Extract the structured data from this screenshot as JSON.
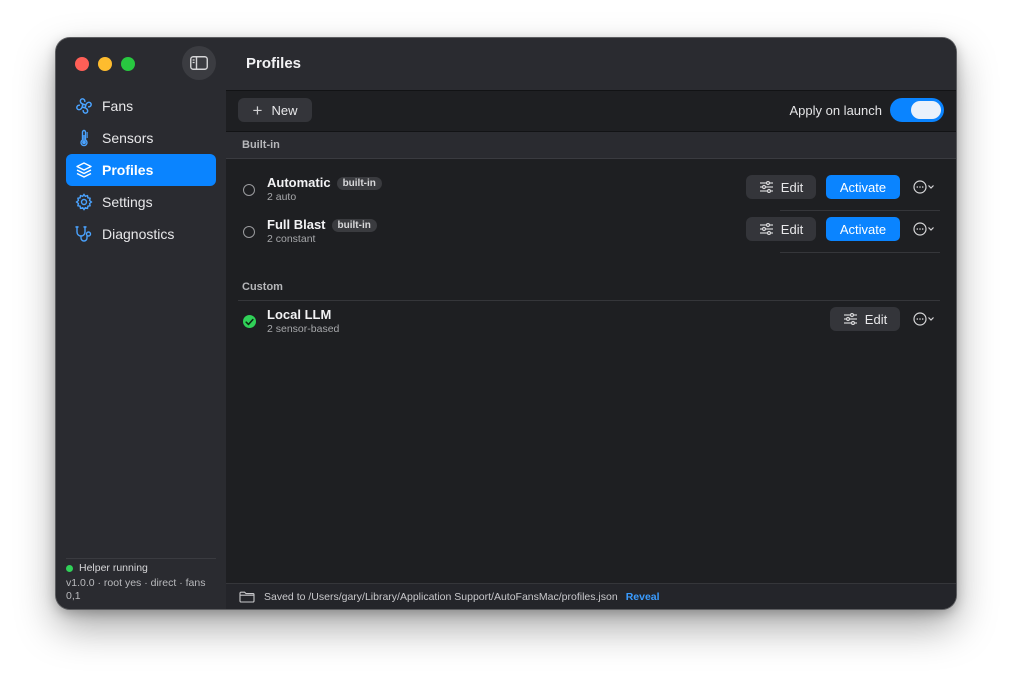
{
  "sidebar": {
    "items": [
      {
        "label": "Fans",
        "icon": "fan-icon"
      },
      {
        "label": "Sensors",
        "icon": "thermometer-icon"
      },
      {
        "label": "Profiles",
        "icon": "layers-icon",
        "active": true
      },
      {
        "label": "Settings",
        "icon": "gear-icon"
      },
      {
        "label": "Diagnostics",
        "icon": "stethoscope-icon"
      }
    ],
    "status": {
      "label": "Helper running",
      "meta": "v1.0.0 · root yes · direct · fans 0,1",
      "color": "#30d158"
    }
  },
  "header": {
    "title": "Profiles"
  },
  "toolbar": {
    "new_label": "New",
    "apply_label": "Apply on launch",
    "apply_on": true
  },
  "sections": {
    "builtin": {
      "label": "Built-in",
      "rows": [
        {
          "name": "Automatic",
          "badge": "built-in",
          "sub": "2 auto",
          "edit": "Edit",
          "activate": "Activate"
        },
        {
          "name": "Full Blast",
          "badge": "built-in",
          "sub": "2 constant",
          "edit": "Edit",
          "activate": "Activate"
        }
      ]
    },
    "custom": {
      "label": "Custom",
      "rows": [
        {
          "name": "Local LLM",
          "sub": "2 sensor-based",
          "edit": "Edit",
          "active": true
        }
      ]
    }
  },
  "footer": {
    "saved_text": "Saved to /Users/gary/Library/Application Support/AutoFansMac/profiles.json",
    "reveal_label": "Reveal"
  },
  "colors": {
    "accent": "#0a84ff",
    "active_check": "#30d158"
  }
}
